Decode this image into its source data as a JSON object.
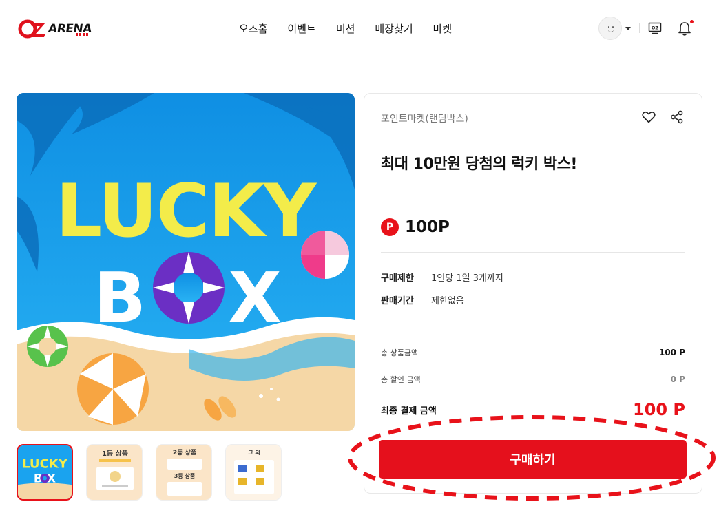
{
  "header": {
    "logo": {
      "oz": "OZ",
      "text": "ARENA"
    },
    "nav": [
      "오즈홈",
      "이벤트",
      "미션",
      "매장찾기",
      "마켓"
    ],
    "tv_label": "OZ"
  },
  "gallery": {
    "main_text": {
      "line1": "LUCKY",
      "line2_left": "B",
      "line2_right": "X"
    },
    "thumbnails": [
      {
        "label": "LUCKY BOX"
      },
      {
        "label": "1등 상품"
      },
      {
        "label": "2등 상품"
      },
      {
        "label": "그 외"
      }
    ]
  },
  "product": {
    "category": "포인트마켓(랜덤박스)",
    "title": "최대 10만원 당첨의 럭키 박스!",
    "point_badge": "P",
    "price": "100P",
    "info": [
      {
        "key": "구매제한",
        "value": "1인당 1일 3개까지"
      },
      {
        "key": "판매기간",
        "value": "제한없음"
      }
    ],
    "summary": {
      "total_label": "총 상품금액",
      "total_value": "100 P",
      "discount_label": "총 할인 금액",
      "discount_value": "0 P",
      "final_label": "최종 결제 금액",
      "final_value": "100 P"
    },
    "buy_label": "구매하기"
  },
  "colors": {
    "accent": "#e5101c",
    "sky": "#1aa3ef",
    "lucky_yellow": "#f3ec4a",
    "ring_purple": "#6b2fc4"
  }
}
